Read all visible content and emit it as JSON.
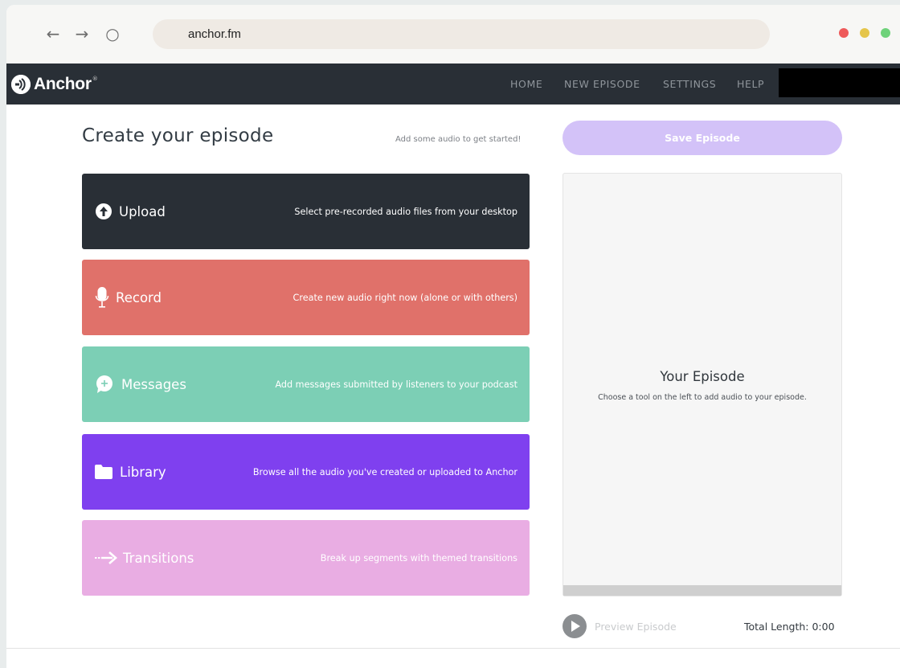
{
  "browser": {
    "back_icon": "←",
    "forward_icon": "→",
    "reload_icon": "○",
    "url": "anchor.fm",
    "window_dots": [
      {
        "name": "close",
        "color": "#ee5a5a"
      },
      {
        "name": "minimize",
        "color": "#e5c54a"
      },
      {
        "name": "maximize",
        "color": "#6ed27a"
      }
    ]
  },
  "header": {
    "logo_text": "Anchor",
    "logo_reg": "®",
    "nav": [
      "HOME",
      "NEW EPISODE",
      "SETTINGS",
      "HELP"
    ]
  },
  "main": {
    "title": "Create your episode",
    "hint": "Add some audio to get started!",
    "tools": [
      {
        "name": "Upload",
        "description": "Select pre-recorded audio files from your desktop",
        "icon": "upload-icon",
        "color": "#292f36",
        "label_color": "#ffffff",
        "desc_color": "#ffffff"
      },
      {
        "name": "Record",
        "description": "Create new audio right now (alone or with others)",
        "icon": "microphone-icon",
        "color": "#e0716a",
        "label_color": "#ffffff",
        "desc_color": "#ffffff"
      },
      {
        "name": "Messages",
        "description": "Add messages submitted by listeners to your podcast",
        "icon": "message-icon",
        "color": "#7ccfb5",
        "label_color": "#ffffff",
        "desc_color": "#ffffff"
      },
      {
        "name": "Library",
        "description": "Browse all the audio you've created or uploaded to Anchor",
        "icon": "folder-icon",
        "color": "#7f40ef",
        "label_color": "#ffffff",
        "desc_color": "#ffffff"
      },
      {
        "name": "Transitions",
        "description": "Break up segments with themed transitions",
        "icon": "arrow-icon",
        "color": "#e9ade3",
        "label_color": "#ffffff",
        "desc_color": "#ffffff"
      }
    ]
  },
  "episode": {
    "save_label": "Save Episode",
    "title": "Your Episode",
    "subtitle": "Choose a tool on the left to add audio to your episode.",
    "preview_label": "Preview Episode",
    "total_length": "Total Length: 0:00"
  },
  "colors": {
    "save_button": "#d3c2f8",
    "header_bg": "#292f36"
  }
}
